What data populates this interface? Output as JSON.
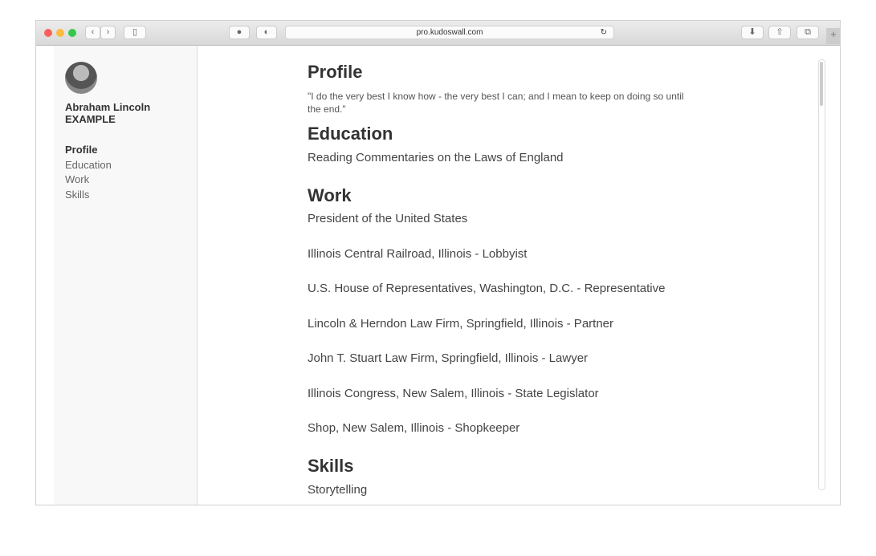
{
  "browser": {
    "url": "pro.kudoswall.com"
  },
  "sidebar": {
    "name": "Abraham Lincoln",
    "subtitle": "EXAMPLE",
    "nav": [
      "Profile",
      "Education",
      "Work",
      "Skills"
    ]
  },
  "profile": {
    "heading": "Profile",
    "quote": "\"I do the very best I know how - the very best I can; and I mean to keep on doing so until the end.\""
  },
  "education": {
    "heading": "Education",
    "items": [
      "Reading Commentaries on the Laws of England"
    ]
  },
  "work": {
    "heading": "Work",
    "items": [
      "President of the United States",
      "Illinois Central Railroad, Illinois - Lobbyist",
      "U.S. House of Representatives, Washington, D.C. - Representative",
      "Lincoln & Herndon Law Firm, Springfield, Illinois - Partner",
      "John T. Stuart Law Firm, Springfield, Illinois - Lawyer",
      "Illinois Congress, New Salem, Illinois - State Legislator",
      "Shop, New Salem, Illinois - Shopkeeper"
    ]
  },
  "skills": {
    "heading": "Skills",
    "items": [
      "Storytelling"
    ]
  }
}
